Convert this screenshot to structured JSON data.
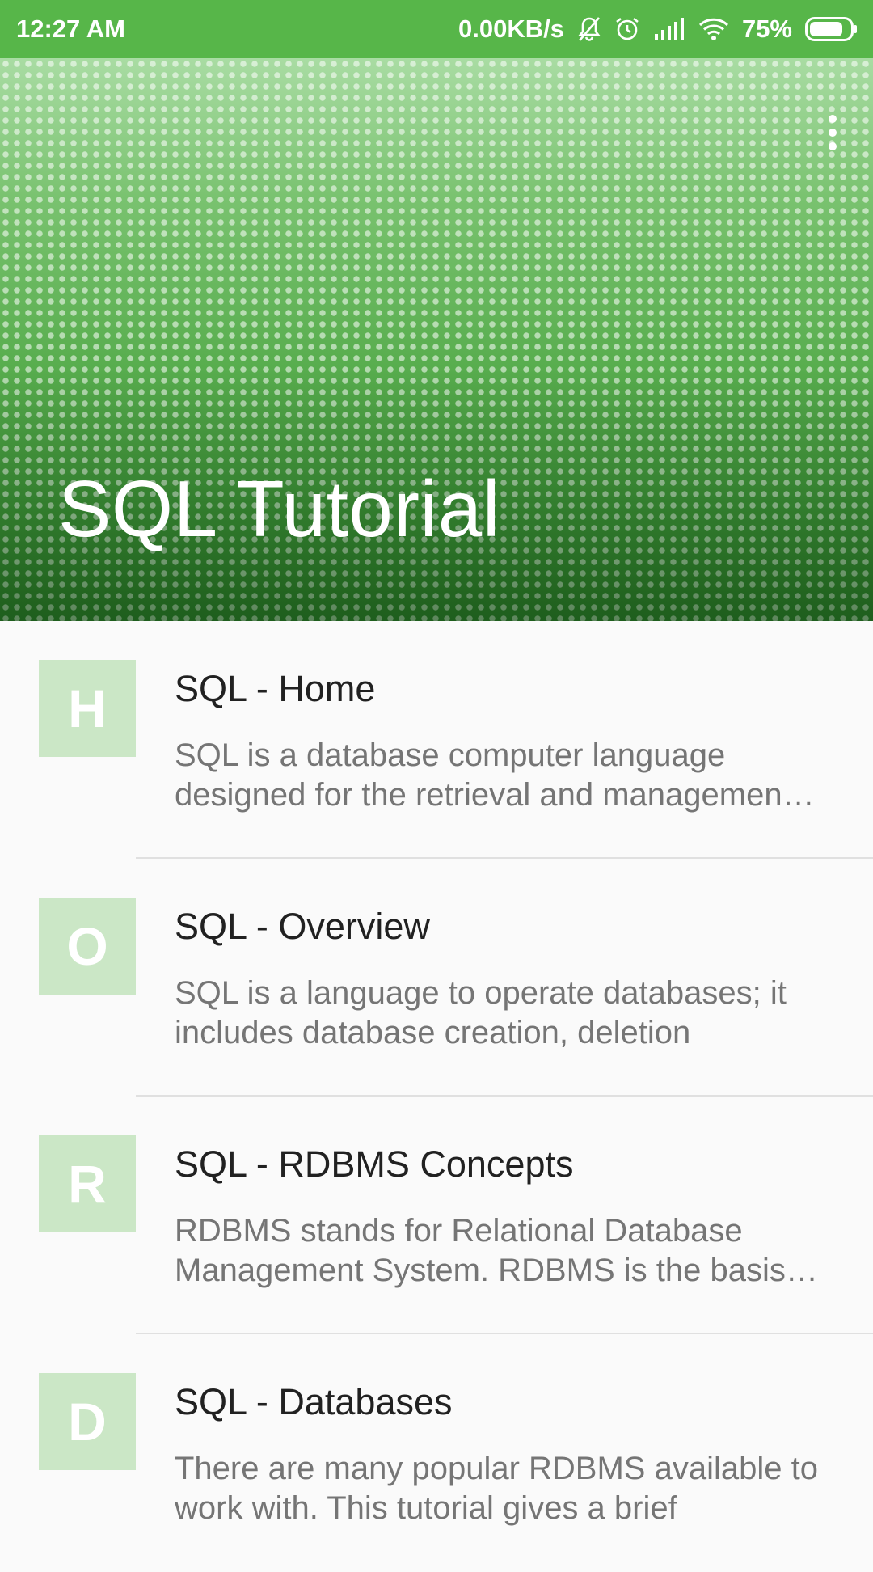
{
  "status_bar": {
    "time": "12:27 AM",
    "net_speed": "0.00KB/s",
    "battery": "75%",
    "icons": [
      "bell-off-icon",
      "alarm-icon",
      "signal-icon",
      "wifi-icon",
      "battery-icon"
    ]
  },
  "header": {
    "title": "SQL Tutorial",
    "menu_icon": "more-vert-icon"
  },
  "colors": {
    "status_bar": "#57b649",
    "header": "#3f9b3a",
    "avatar_bg": "#cbe7c6",
    "title_text": "#212121",
    "desc_text": "#757575"
  },
  "items": [
    {
      "letter": "H",
      "title": "SQL - Home",
      "line1": "SQL is a database computer language",
      "line2": "designed for the retrieval and managemen…"
    },
    {
      "letter": "O",
      "title": "SQL - Overview",
      "line1": "SQL is a language to operate databases; it",
      "line2": "includes database creation, deletion"
    },
    {
      "letter": "R",
      "title": "SQL - RDBMS Concepts",
      "line1": "RDBMS stands for Relational Database",
      "line2": "Management System. RDBMS is the basis…"
    },
    {
      "letter": "D",
      "title": "SQL - Databases",
      "line1": "There are many popular RDBMS available to",
      "line2": "work with. This tutorial gives a brief"
    }
  ]
}
